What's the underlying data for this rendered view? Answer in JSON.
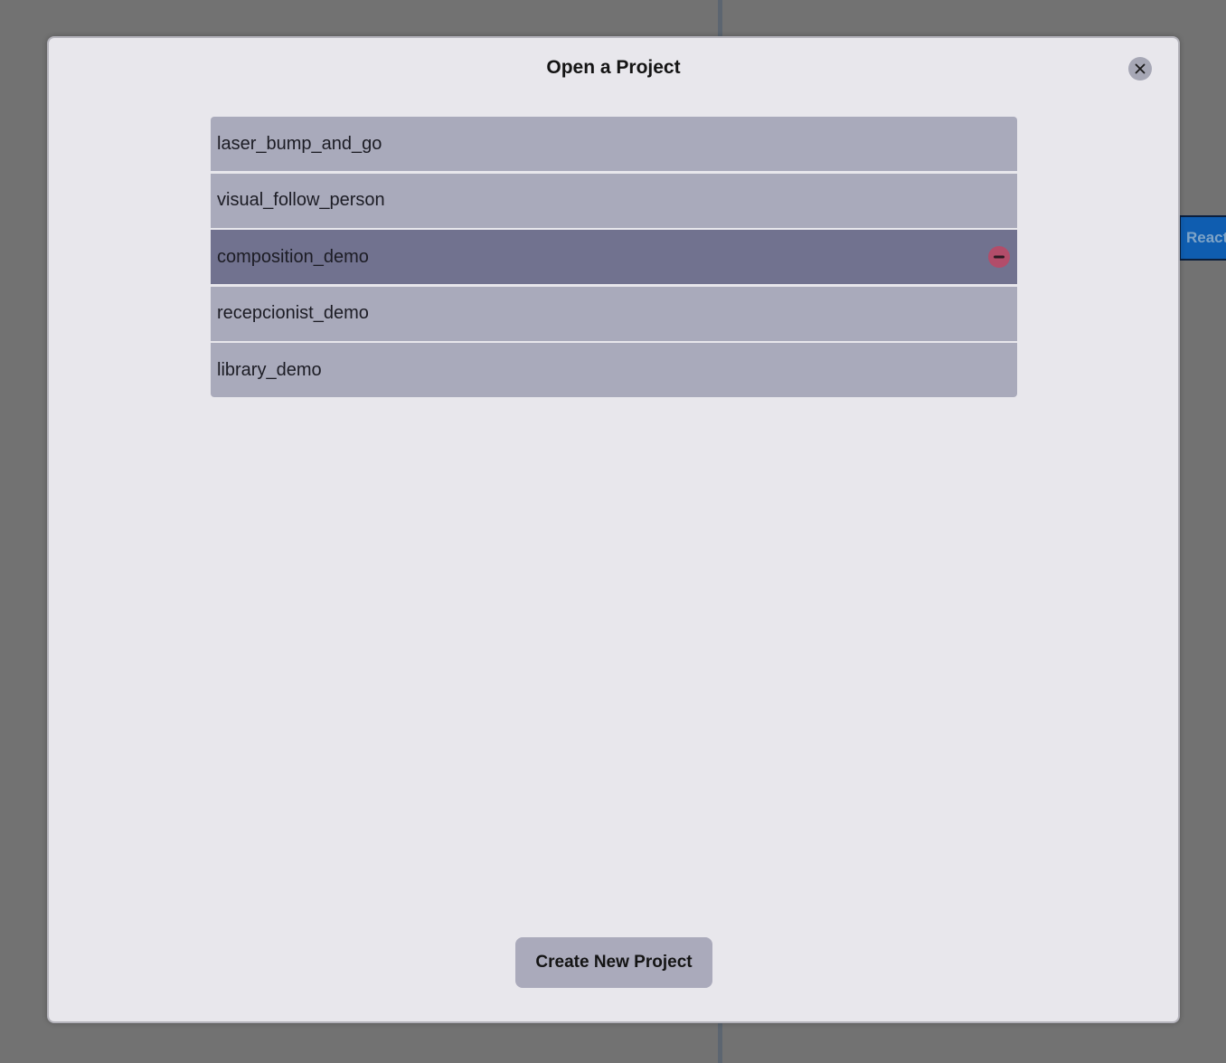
{
  "background": {
    "react_button_label": "React"
  },
  "modal": {
    "title": "Open a Project",
    "close_icon": "close-icon",
    "projects": [
      {
        "name": "laser_bump_and_go",
        "selected": false
      },
      {
        "name": "visual_follow_person",
        "selected": false
      },
      {
        "name": "composition_demo",
        "selected": true
      },
      {
        "name": "recepcionist_demo",
        "selected": false
      },
      {
        "name": "library_demo",
        "selected": false
      }
    ],
    "delete_icon": "minus-icon",
    "create_button_label": "Create New Project"
  },
  "colors": {
    "backdrop": "#727272",
    "modal_background": "#e8e7ec",
    "item_background": "#a9aabb",
    "item_selected_background": "#71728f",
    "delete_button": "#b24d6a",
    "react_button": "#0f5db0"
  }
}
